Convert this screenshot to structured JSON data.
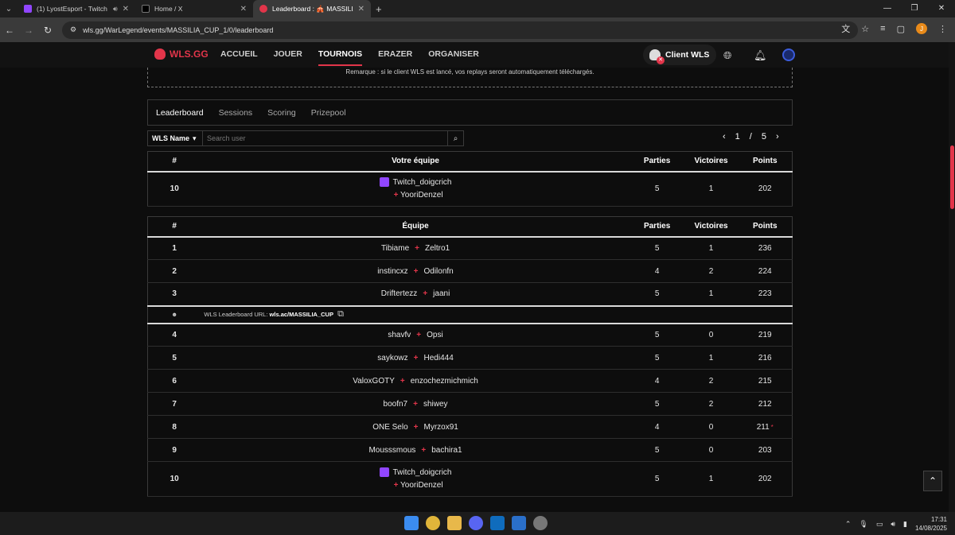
{
  "browser": {
    "tabs": [
      {
        "title": "(1) LyostEsport - Twitch",
        "color": "#9146ff",
        "active": false
      },
      {
        "title": "Home / X",
        "color": "#000000",
        "active": false
      },
      {
        "title": "Leaderboard : 🎪 MASSILIA CU",
        "color": "#e2354a",
        "active": true
      }
    ],
    "url": "wls.gg/WarLegend/events/MASSILIA_CUP_1/0/leaderboard",
    "profile_initial": "J"
  },
  "site": {
    "logo": "WLS.GG",
    "nav": [
      "ACCUEIL",
      "JOUER",
      "TOURNOIS",
      "ERAZER",
      "ORGANISER"
    ],
    "active_nav": "TOURNOIS",
    "client_label": "Client WLS"
  },
  "notice": "Remarque : si le client WLS est lancé, vos replays seront automatiquement téléchargés.",
  "subtabs": [
    "Leaderboard",
    "Sessions",
    "Scoring",
    "Prizepool"
  ],
  "filter": {
    "select_label": "WLS Name",
    "search_placeholder": "Search user"
  },
  "pager": {
    "current": "1",
    "separator": "/",
    "total": "5"
  },
  "my_team": {
    "headers": {
      "rank": "#",
      "team": "Votre équipe",
      "parties": "Parties",
      "victoires": "Victoires",
      "points": "Points"
    },
    "row": {
      "rank": "10",
      "p1": "Twitch_doigcrich",
      "p2": "YooriDenzel",
      "parties": "5",
      "victoires": "1",
      "points": "202"
    }
  },
  "leaderboard": {
    "headers": {
      "rank": "#",
      "team": "Équipe",
      "parties": "Parties",
      "victoires": "Victoires",
      "points": "Points"
    },
    "rows": [
      {
        "rank": "1",
        "p1": "Tibiame",
        "p2": "Zeltro1",
        "parties": "5",
        "victoires": "1",
        "points": "236"
      },
      {
        "rank": "2",
        "p1": "instincxz",
        "p2": "Odilonfn",
        "parties": "4",
        "victoires": "2",
        "points": "224"
      },
      {
        "rank": "3",
        "p1": "Driftertezz",
        "p2": "jaani",
        "parties": "5",
        "victoires": "1",
        "points": "223"
      },
      {
        "rank": "4",
        "p1": "shavfv",
        "p2": "Opsi",
        "parties": "5",
        "victoires": "0",
        "points": "219"
      },
      {
        "rank": "5",
        "p1": "saykowz",
        "p2": "Hedi444",
        "parties": "5",
        "victoires": "1",
        "points": "216"
      },
      {
        "rank": "6",
        "p1": "ValoxGOTY",
        "p2": "enzochezmichmich",
        "parties": "4",
        "victoires": "2",
        "points": "215"
      },
      {
        "rank": "7",
        "p1": "boofn7",
        "p2": "shiwey",
        "parties": "5",
        "victoires": "2",
        "points": "212"
      },
      {
        "rank": "8",
        "p1": "ONE Selo",
        "p2": "Myrzox91",
        "parties": "4",
        "victoires": "0",
        "points": "211",
        "flag": "*"
      },
      {
        "rank": "9",
        "p1": "Mousssmous",
        "p2": "bachira1",
        "parties": "5",
        "victoires": "0",
        "points": "203"
      },
      {
        "rank": "10",
        "p1": "Twitch_doigcrich",
        "p2": "YooriDenzel",
        "parties": "5",
        "victoires": "1",
        "points": "202"
      }
    ],
    "url_row": {
      "label": "WLS Leaderboard URL:",
      "value": "wls.ac/MASSILIA_CUP"
    }
  },
  "taskbar": {
    "time": "17:31",
    "date": "14/08/2025"
  }
}
